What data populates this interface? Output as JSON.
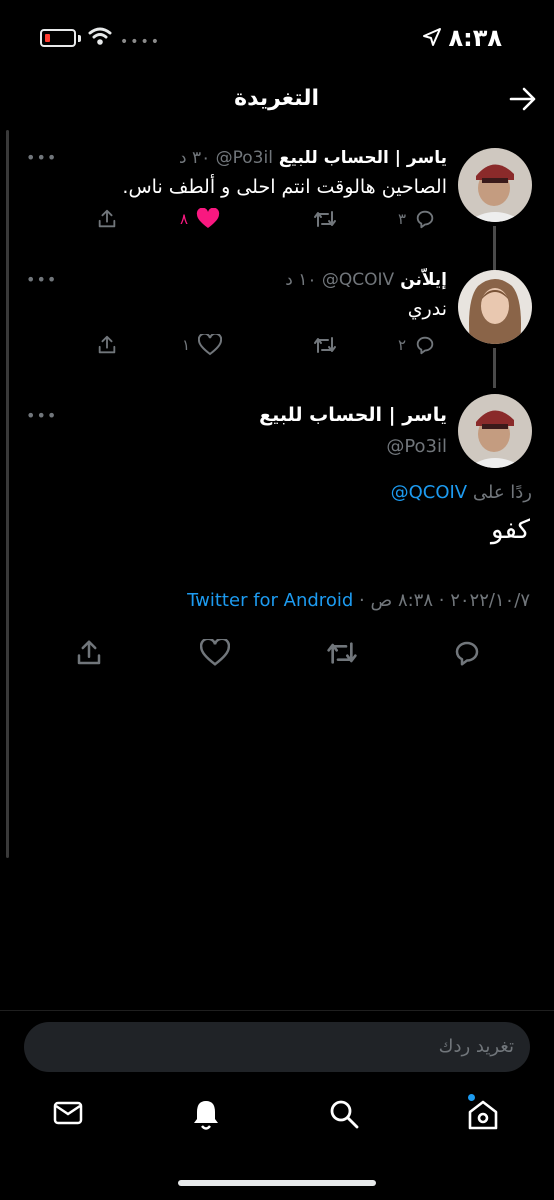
{
  "status_bar": {
    "time": "٨:٣٨"
  },
  "header": {
    "title": "التغريدة"
  },
  "tweets": [
    {
      "name": "ياسر | الحساب للبيع",
      "meta": "‎@Po3il‎ ٣٠ د",
      "text": "الصاحين هالوقت انتم احلى و ألطف ناس.",
      "replies": "٣",
      "likes": "٨",
      "liked": true
    },
    {
      "name": "إيلاّنن",
      "meta": "‎@QCOIV‎ ١٠ د",
      "text": "ندري",
      "replies": "٢",
      "likes": "١",
      "liked": false
    }
  ],
  "main_tweet": {
    "name": "ياسر | الحساب للبيع",
    "handle": "@Po3il",
    "reply_prefix": "ردًا على",
    "reply_to": "@QCOIV",
    "text": "كفو",
    "datetime": "٢٠٢٢/١٠/٧ · ٨:٣٨ ص ·",
    "source": "Twitter for Android"
  },
  "reply_box": {
    "placeholder": "تغريد ردك"
  },
  "colors": {
    "accent": "#1d9bf0",
    "like": "#f91880",
    "muted": "#71767b"
  },
  "icons": [
    "back-arrow-icon",
    "reply-icon",
    "retweet-icon",
    "like-icon",
    "share-icon",
    "mail-icon",
    "bell-icon",
    "search-icon",
    "home-icon",
    "more-icon"
  ]
}
